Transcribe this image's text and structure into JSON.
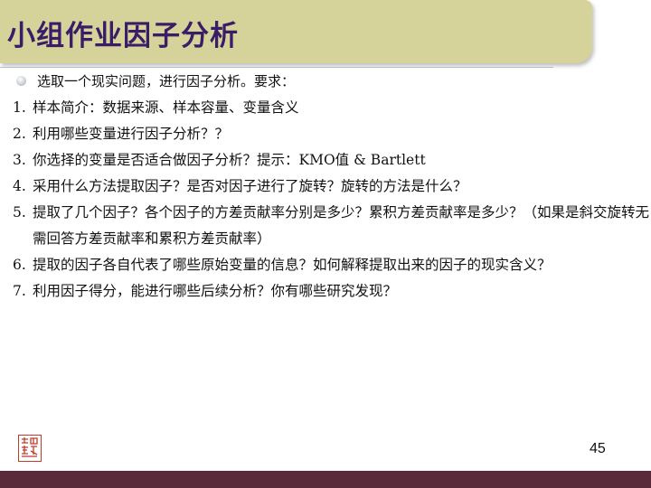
{
  "slide": {
    "title": "小组作业因子分析",
    "bullet": "选取一个现实问题，进行因子分析。要求：",
    "items": [
      {
        "num": "1.",
        "text": "样本简介：数据来源、样本容量、变量含义"
      },
      {
        "num": "2.",
        "text": "利用哪些变量进行因子分析？？"
      },
      {
        "num": "3.",
        "text": "你选择的变量是否适合做因子分析？提示：KMO值 & Bartlett"
      },
      {
        "num": "4.",
        "text": "采用什么方法提取因子？是否对因子进行了旋转？旋转的方法是什么？"
      },
      {
        "num": "5.",
        "text": "提取了几个因子？各个因子的方差贡献率分别是多少？累积方差贡献率是多少？（如果是斜交旋转无需回答方差贡献率和累积方差贡献率）"
      },
      {
        "num": "6.",
        "text": "提取的因子各自代表了哪些原始变量的信息？如何解释提取出来的因子的现实含义？"
      },
      {
        "num": "7.",
        "text": "利用因子得分，能进行哪些后续分析？你有哪些研究发现？"
      }
    ],
    "page_number": "45",
    "seal_icon": "red-seal-logo"
  },
  "colors": {
    "title_bar": "#d6d39a",
    "title_text": "#3a1d66",
    "footer_bar": "#5a2a3a",
    "seal": "#c23a2a"
  }
}
